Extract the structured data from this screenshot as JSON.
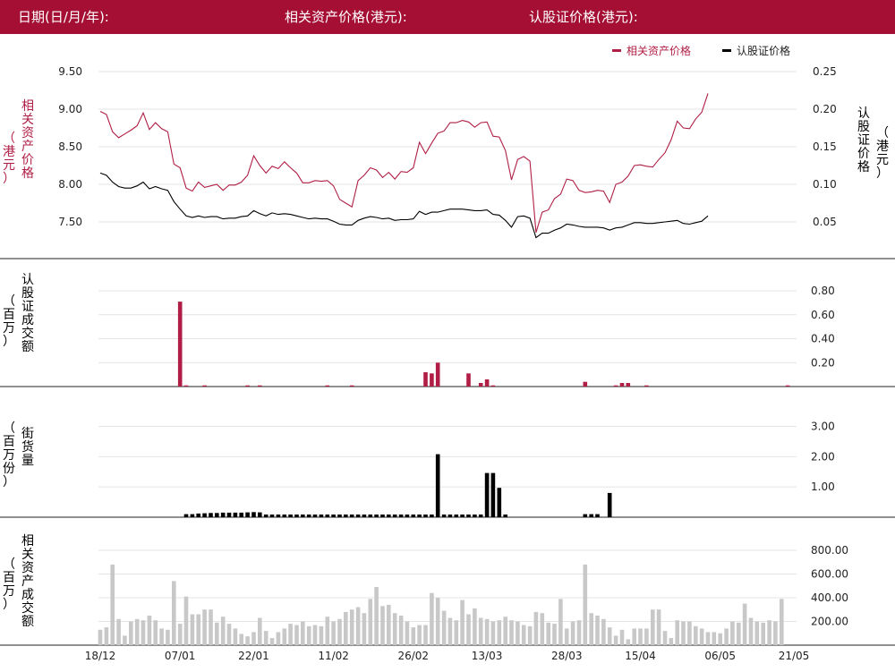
{
  "header": {
    "date_label": "日期(日/月/年):",
    "asset_price_label": "相关资产价格(港元):",
    "warrant_price_label": "认股证价格(港元):"
  },
  "colors": {
    "asset": "#b01e45",
    "warrant": "#000000",
    "volume_bar": "#c8c8c8",
    "header_bg": "#a50f34"
  },
  "axis_titles": {
    "price_left": "相关资产价格",
    "price_left_unit": "（港元）",
    "price_right": "认股证价格",
    "price_right_unit": "（港元）",
    "warrant_turnover": "认股证成交额",
    "warrant_turnover_unit": "（百万）",
    "outstanding": "街货量",
    "outstanding_unit": "（百万份）",
    "asset_turnover": "相关资产成交额",
    "asset_turnover_unit": "（百万）"
  },
  "chart_data": [
    {
      "type": "line",
      "title": "",
      "legend_position": "top-right",
      "x_count": 114,
      "x_ticks": [
        {
          "index": 0,
          "label": "18/12"
        },
        {
          "index": 13,
          "label": "07/01"
        },
        {
          "index": 25,
          "label": "22/01"
        },
        {
          "index": 38,
          "label": "11/02"
        },
        {
          "index": 51,
          "label": "26/02"
        },
        {
          "index": 63,
          "label": "13/03"
        },
        {
          "index": 76,
          "label": "28/03"
        },
        {
          "index": 88,
          "label": "15/04"
        },
        {
          "index": 101,
          "label": "06/05"
        },
        {
          "index": 113,
          "label": "21/05"
        }
      ],
      "left_axis": {
        "ticks": [
          "7.50",
          "8.00",
          "8.50",
          "9.00",
          "9.50"
        ],
        "range": [
          7.2,
          9.5
        ]
      },
      "right_axis": {
        "ticks": [
          "0.05",
          "0.10",
          "0.15",
          "0.20",
          "0.25"
        ],
        "range": [
          0.0144,
          0.25
        ]
      },
      "series": [
        {
          "name": "相关资产价格",
          "axis": "left",
          "values": [
            8.97,
            8.93,
            8.7,
            8.62,
            8.67,
            8.72,
            8.78,
            8.95,
            8.73,
            8.82,
            8.74,
            8.7,
            8.27,
            8.22,
            7.95,
            7.91,
            8.03,
            7.96,
            7.98,
            8.0,
            7.92,
            7.99,
            7.99,
            8.03,
            8.12,
            8.38,
            8.25,
            8.15,
            8.24,
            8.21,
            8.3,
            8.22,
            8.15,
            8.02,
            8.02,
            8.05,
            8.04,
            8.05,
            7.98,
            7.8,
            7.75,
            7.7,
            8.05,
            8.12,
            8.22,
            8.19,
            8.09,
            8.16,
            8.07,
            8.17,
            8.16,
            8.22,
            8.56,
            8.41,
            8.55,
            8.68,
            8.71,
            8.82,
            8.82,
            8.85,
            8.83,
            8.76,
            8.82,
            8.83,
            8.64,
            8.63,
            8.45,
            8.06,
            8.33,
            8.37,
            8.31,
            7.36,
            7.63,
            7.66,
            7.81,
            7.87,
            8.07,
            8.05,
            7.92,
            7.89,
            7.9,
            7.92,
            7.91,
            7.76,
            8.0,
            8.03,
            8.11,
            8.25,
            8.26,
            8.24,
            8.23,
            8.33,
            8.42,
            8.59,
            8.84,
            8.75,
            8.74,
            8.87,
            8.96,
            9.21
          ]
        },
        {
          "name": "认股证价格",
          "axis": "right",
          "values": [
            0.115,
            0.112,
            0.103,
            0.097,
            0.095,
            0.095,
            0.098,
            0.103,
            0.094,
            0.097,
            0.094,
            0.092,
            0.077,
            0.067,
            0.058,
            0.056,
            0.058,
            0.056,
            0.057,
            0.057,
            0.054,
            0.055,
            0.055,
            0.057,
            0.058,
            0.065,
            0.061,
            0.058,
            0.062,
            0.06,
            0.061,
            0.06,
            0.058,
            0.056,
            0.054,
            0.055,
            0.054,
            0.054,
            0.051,
            0.047,
            0.046,
            0.046,
            0.052,
            0.055,
            0.057,
            0.056,
            0.054,
            0.055,
            0.052,
            0.053,
            0.053,
            0.054,
            0.064,
            0.06,
            0.063,
            0.063,
            0.065,
            0.067,
            0.067,
            0.067,
            0.066,
            0.065,
            0.065,
            0.066,
            0.06,
            0.059,
            0.052,
            0.043,
            0.057,
            0.058,
            0.055,
            0.029,
            0.035,
            0.035,
            0.039,
            0.042,
            0.047,
            0.046,
            0.044,
            0.043,
            0.043,
            0.043,
            0.042,
            0.039,
            0.042,
            0.043,
            0.046,
            0.049,
            0.049,
            0.048,
            0.048,
            0.049,
            0.05,
            0.051,
            0.052,
            0.048,
            0.047,
            0.049,
            0.051,
            0.058
          ]
        }
      ]
    },
    {
      "type": "bar",
      "title": "",
      "y_ticks": [
        "0.20",
        "0.40",
        "0.60",
        "0.80"
      ],
      "ylim": [
        0,
        0.86
      ],
      "values": [
        0,
        0,
        0,
        0,
        0,
        0,
        0,
        0,
        0,
        0,
        0,
        0,
        0,
        0.71,
        0.01,
        0,
        0,
        0.01,
        0,
        0,
        0,
        0,
        0,
        0,
        0.01,
        0,
        0.01,
        0,
        0,
        0,
        0,
        0,
        0,
        0,
        0,
        0,
        0,
        0.01,
        0,
        0,
        0,
        0.01,
        0,
        0,
        0,
        0,
        0,
        0,
        0,
        0,
        0,
        0,
        0,
        0.12,
        0.11,
        0.2,
        0,
        0,
        0,
        0,
        0.11,
        0,
        0.03,
        0.06,
        0.01,
        0,
        0,
        0,
        0,
        0,
        0,
        0,
        0,
        0,
        0,
        0,
        0,
        0,
        0,
        0.04,
        0,
        0,
        0,
        0,
        0.01,
        0.03,
        0.03,
        0,
        0,
        0.01,
        0,
        0,
        0,
        0,
        0,
        0,
        0,
        0,
        0,
        0,
        0,
        0,
        0,
        0,
        0,
        0,
        0,
        0,
        0,
        0,
        0,
        0,
        0.01,
        0
      ]
    },
    {
      "type": "bar",
      "title": "",
      "y_ticks": [
        "1.00",
        "2.00",
        "3.00"
      ],
      "ylim": [
        0,
        3.4
      ],
      "values": [
        0,
        0,
        0,
        0,
        0,
        0,
        0,
        0,
        0,
        0,
        0,
        0,
        0,
        0,
        0.1,
        0.1,
        0.12,
        0.13,
        0.14,
        0.14,
        0.15,
        0.15,
        0.15,
        0.15,
        0.16,
        0.17,
        0.16,
        0.09,
        0.09,
        0.09,
        0.09,
        0.09,
        0.09,
        0.09,
        0.09,
        0.09,
        0.09,
        0.09,
        0.09,
        0.09,
        0.09,
        0.09,
        0.09,
        0.09,
        0.09,
        0.09,
        0.09,
        0.09,
        0.09,
        0.09,
        0.09,
        0.09,
        0.09,
        0.09,
        0.09,
        2.08,
        0.09,
        0.09,
        0.09,
        0.09,
        0.09,
        0.09,
        0.09,
        1.46,
        1.46,
        0.97,
        0.09,
        0,
        0,
        0,
        0,
        0,
        0,
        0,
        0,
        0,
        0,
        0,
        0,
        0.1,
        0.1,
        0.1,
        0,
        0.8,
        0,
        0,
        0,
        0,
        0,
        0,
        0,
        0,
        0,
        0,
        0,
        0,
        0,
        0,
        0,
        0,
        0,
        0,
        0,
        0,
        0,
        0,
        0,
        0,
        0,
        0,
        0,
        0,
        0,
        0
      ]
    },
    {
      "type": "bar",
      "title": "",
      "y_ticks": [
        "200.00",
        "400.00",
        "600.00",
        "800.00"
      ],
      "ylim": [
        0,
        860
      ],
      "values": [
        130,
        150,
        680,
        220,
        80,
        200,
        220,
        210,
        250,
        210,
        140,
        130,
        540,
        180,
        410,
        260,
        260,
        300,
        300,
        190,
        240,
        180,
        140,
        95,
        75,
        110,
        230,
        120,
        60,
        110,
        140,
        180,
        170,
        200,
        160,
        170,
        160,
        240,
        200,
        220,
        280,
        300,
        320,
        270,
        390,
        490,
        330,
        340,
        270,
        250,
        200,
        150,
        170,
        170,
        440,
        400,
        290,
        230,
        210,
        380,
        260,
        310,
        230,
        220,
        200,
        210,
        240,
        210,
        200,
        170,
        160,
        280,
        270,
        190,
        180,
        390,
        140,
        200,
        210,
        680,
        270,
        250,
        220,
        150,
        80,
        130,
        50,
        140,
        140,
        140,
        300,
        300,
        120,
        60,
        210,
        200,
        200,
        160,
        140,
        110,
        110,
        100,
        140,
        200,
        190,
        350,
        230,
        200,
        190,
        210,
        200,
        390
      ]
    }
  ]
}
